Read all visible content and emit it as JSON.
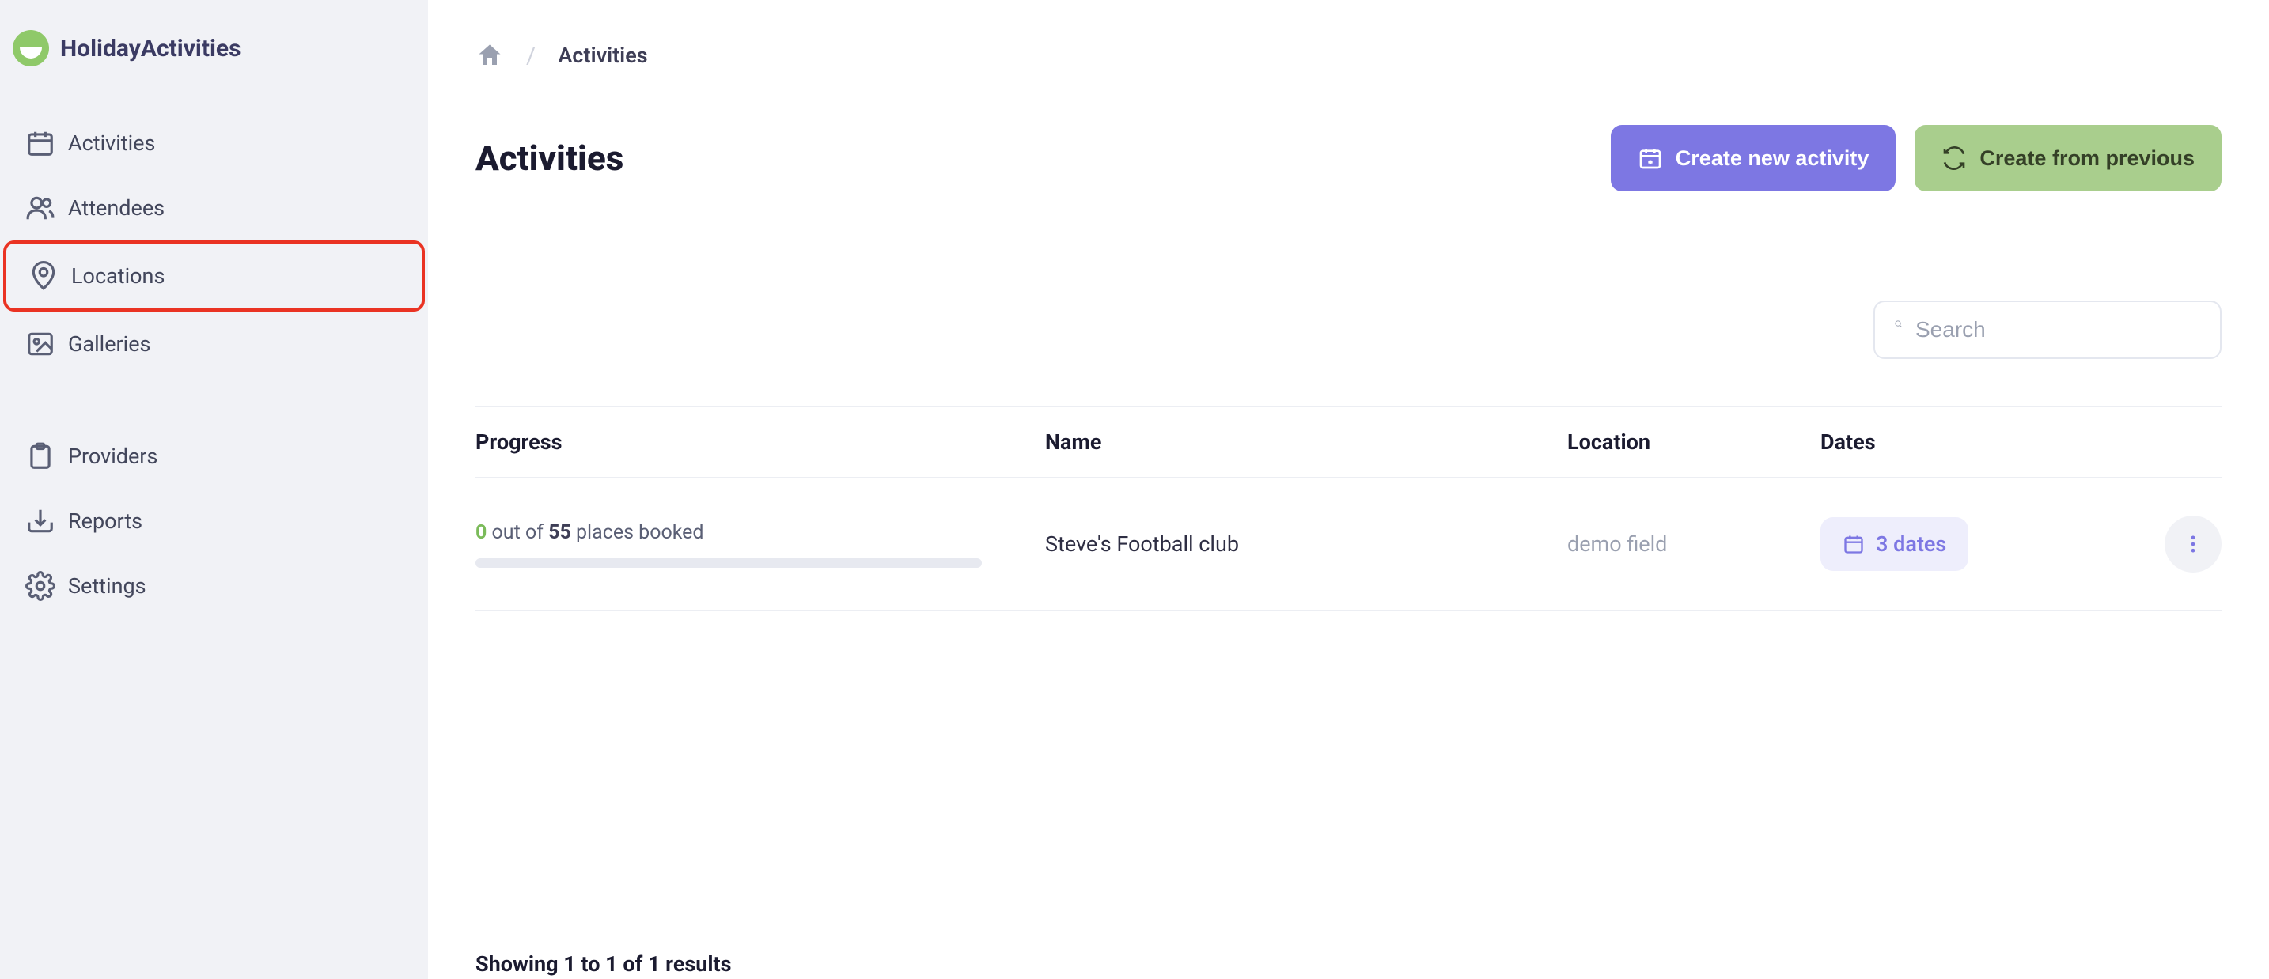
{
  "brand": {
    "name": "HolidayActivities"
  },
  "sidebar": {
    "items": [
      {
        "label": "Activities",
        "icon": "calendar"
      },
      {
        "label": "Attendees",
        "icon": "users"
      },
      {
        "label": "Locations",
        "icon": "location",
        "highlighted": true
      },
      {
        "label": "Galleries",
        "icon": "image"
      }
    ],
    "items2": [
      {
        "label": "Providers",
        "icon": "clipboard"
      },
      {
        "label": "Reports",
        "icon": "download"
      },
      {
        "label": "Settings",
        "icon": "gear"
      }
    ]
  },
  "breadcrumb": {
    "current": "Activities"
  },
  "page": {
    "title": "Activities"
  },
  "actions": {
    "create_new": "Create new activity",
    "create_from_previous": "Create from previous"
  },
  "search": {
    "placeholder": "Search"
  },
  "table": {
    "headers": {
      "progress": "Progress",
      "name": "Name",
      "location": "Location",
      "dates": "Dates"
    },
    "rows": [
      {
        "progress": {
          "booked": "0",
          "total": "55",
          "prefix_out_of": " out of ",
          "suffix": " places booked"
        },
        "name": "Steve's Football club",
        "location": "demo field",
        "dates": "3 dates"
      }
    ]
  },
  "pagination": {
    "text": "Showing 1 to 1 of 1 results"
  }
}
